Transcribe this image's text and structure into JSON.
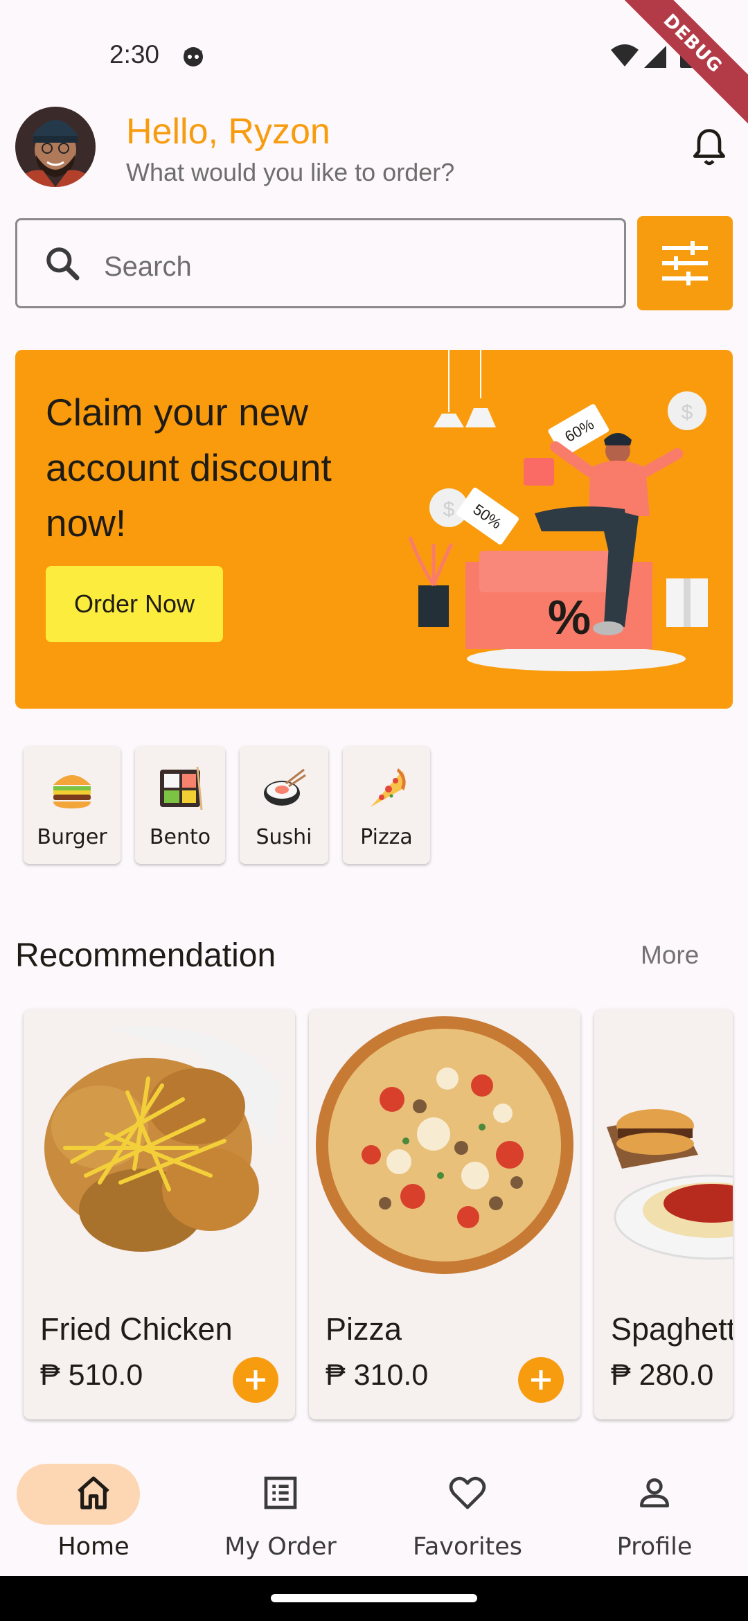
{
  "status_bar": {
    "time": "2:30",
    "debug_label": "DEBUG"
  },
  "header": {
    "greeting": "Hello, Ryzon",
    "subtitle": "What would you like to order?"
  },
  "search": {
    "placeholder": "Search"
  },
  "banner": {
    "title": "Claim your new account discount now!",
    "button_label": "Order Now",
    "tag_60": "60%",
    "tag_50": "50%",
    "percent_symbol": "%"
  },
  "categories": [
    {
      "label": "Burger",
      "icon": "burger-icon"
    },
    {
      "label": "Bento",
      "icon": "bento-icon"
    },
    {
      "label": "Sushi",
      "icon": "sushi-icon"
    },
    {
      "label": "Pizza",
      "icon": "pizza-icon"
    }
  ],
  "recommendation": {
    "title": "Recommendation",
    "more_label": "More",
    "items": [
      {
        "name": "Fried Chicken",
        "price": "₱ 510.0"
      },
      {
        "name": "Pizza",
        "price": "₱ 310.0"
      },
      {
        "name": "Spaghetti",
        "price": "₱ 280.0"
      }
    ]
  },
  "bottom_nav": [
    {
      "label": "Home",
      "icon": "home-icon",
      "active": true
    },
    {
      "label": "My Order",
      "icon": "order-list-icon"
    },
    {
      "label": "Favorites",
      "icon": "heart-icon"
    },
    {
      "label": "Profile",
      "icon": "person-icon"
    }
  ],
  "colors": {
    "accent": "#f89c0f",
    "banner_bg": "#f99b0d",
    "button_yellow": "#fbec3d",
    "nav_active_pill": "#fdd6b4"
  }
}
